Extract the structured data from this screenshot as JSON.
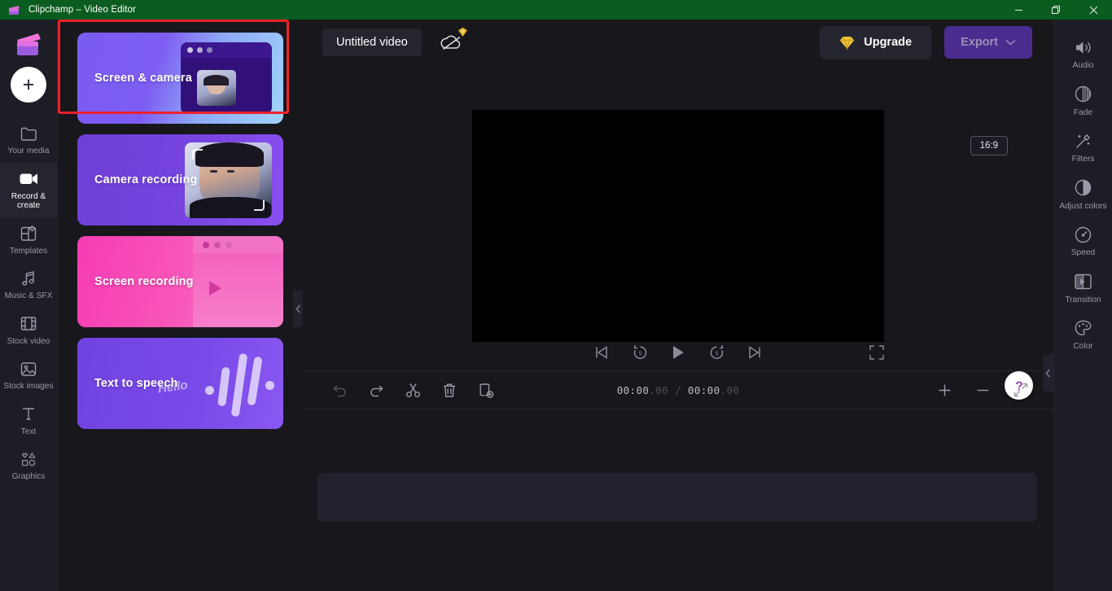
{
  "window": {
    "title": "Clipchamp – Video Editor",
    "titlebar_color": "#0b5c20",
    "controls": {
      "minimize": "—",
      "restore": "restore-icon",
      "close": "✕"
    }
  },
  "left_rail": {
    "logo_name": "clipchamp-logo",
    "add_button_label": "+",
    "items": [
      {
        "label": "Your media",
        "icon": "folder-icon",
        "active": false
      },
      {
        "label": "Record & create",
        "icon": "video-camera-icon",
        "active": true
      },
      {
        "label": "Templates",
        "icon": "templates-icon",
        "active": false
      },
      {
        "label": "Music & SFX",
        "icon": "music-note-icon",
        "active": false
      },
      {
        "label": "Stock video",
        "icon": "film-strip-icon",
        "active": false
      },
      {
        "label": "Stock images",
        "icon": "image-icon",
        "active": false
      },
      {
        "label": "Text",
        "icon": "text-T-icon",
        "active": false
      },
      {
        "label": "Graphics",
        "icon": "shapes-icon",
        "active": false
      }
    ]
  },
  "panel": {
    "cards": [
      {
        "label": "Screen & camera",
        "art": "browser-with-webcam",
        "highlighted": true
      },
      {
        "label": "Camera recording",
        "art": "webcam-portrait",
        "highlighted": false
      },
      {
        "label": "Screen recording",
        "art": "browser-with-play",
        "highlighted": false
      },
      {
        "label": "Text to speech",
        "art": "waveform-hello",
        "highlighted": false
      }
    ],
    "tts_word": "Hello",
    "highlight_color": "#f0202a",
    "collapse_icon": "chevron-left-icon"
  },
  "toolbar": {
    "project_title": "Untitled video",
    "cloud_icon": "cloud-off-icon",
    "cloud_badge_icon": "premium-diamond-icon",
    "upgrade_label": "Upgrade",
    "upgrade_icon": "diamond-icon",
    "export_label": "Export",
    "export_chevron": "chevron-down-icon",
    "export_disabled": true
  },
  "preview": {
    "aspect_ratio_label": "16:9",
    "canvas_color": "#000000",
    "controls": [
      {
        "name": "skip-to-start-button",
        "icon": "skip-back-icon"
      },
      {
        "name": "rewind-5s-button",
        "icon": "rotate-left-5-icon"
      },
      {
        "name": "play-button",
        "icon": "play-icon"
      },
      {
        "name": "forward-5s-button",
        "icon": "rotate-right-5-icon"
      },
      {
        "name": "skip-to-end-button",
        "icon": "skip-forward-icon"
      }
    ],
    "fullscreen_icon": "fullscreen-icon",
    "help_label": "?",
    "collapse_icon": "chevron-left-icon"
  },
  "timeline": {
    "buttons": [
      {
        "name": "undo-button",
        "icon": "undo-icon",
        "disabled": true
      },
      {
        "name": "redo-button",
        "icon": "redo-icon",
        "disabled": false
      },
      {
        "name": "split-button",
        "icon": "scissors-icon",
        "disabled": false
      },
      {
        "name": "delete-button",
        "icon": "trash-icon",
        "disabled": false
      },
      {
        "name": "duplicate-button",
        "icon": "duplicate-icon",
        "disabled": false
      }
    ],
    "current_time": "00:00",
    "current_time_frames": ".00",
    "time_separator": " / ",
    "total_time": "00:00",
    "total_time_frames": ".00",
    "zoom_in_icon": "plus-icon",
    "zoom_out_icon": "minus-icon",
    "fit_icon": "fit-to-screen-icon"
  },
  "right_rail": {
    "items": [
      {
        "label": "Audio",
        "icon": "speaker-icon"
      },
      {
        "label": "Fade",
        "icon": "fade-circle-icon"
      },
      {
        "label": "Filters",
        "icon": "magic-wand-icon"
      },
      {
        "label": "Adjust colors",
        "icon": "contrast-circle-icon"
      },
      {
        "label": "Speed",
        "icon": "speedometer-icon"
      },
      {
        "label": "Transition",
        "icon": "transition-icon"
      },
      {
        "label": "Color",
        "icon": "palette-icon"
      }
    ]
  }
}
